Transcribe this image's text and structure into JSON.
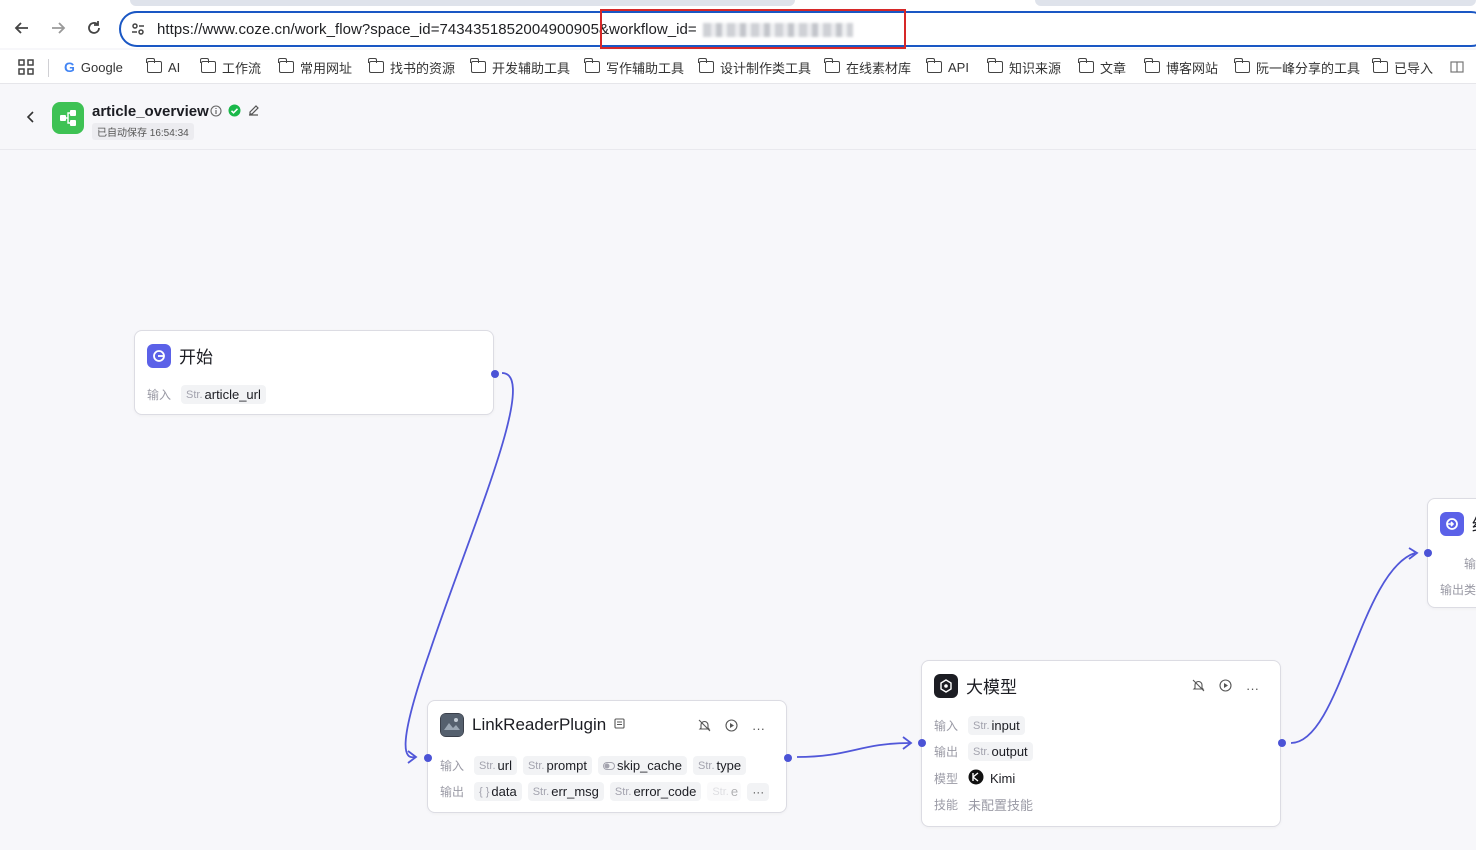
{
  "browser": {
    "url_prefix": "https://www.coze.cn/work_flow?space_id=7434351852004900905",
    "url_highlight": "&workflow_id=",
    "bookmarks": [
      {
        "label": "Google",
        "icon": "google-icon"
      },
      {
        "label": "AI",
        "icon": "folder-icon"
      },
      {
        "label": "工作流",
        "icon": "folder-icon"
      },
      {
        "label": "常用网址",
        "icon": "folder-icon"
      },
      {
        "label": "找书的资源",
        "icon": "folder-icon"
      },
      {
        "label": "开发辅助工具",
        "icon": "folder-icon"
      },
      {
        "label": "写作辅助工具",
        "icon": "folder-icon"
      },
      {
        "label": "设计制作类工具",
        "icon": "folder-icon"
      },
      {
        "label": "在线素材库",
        "icon": "folder-icon"
      },
      {
        "label": "API",
        "icon": "folder-icon"
      },
      {
        "label": "知识来源",
        "icon": "folder-icon"
      },
      {
        "label": "文章",
        "icon": "folder-icon"
      },
      {
        "label": "博客网站",
        "icon": "folder-icon"
      },
      {
        "label": "阮一峰分享的工具",
        "icon": "folder-icon"
      },
      {
        "label": "已导入",
        "icon": "folder-icon"
      }
    ]
  },
  "header": {
    "title": "article_overview",
    "autosave": "已自动保存 16:54:34",
    "status_color": "#1ab84a"
  },
  "nodes": {
    "start": {
      "title": "开始",
      "input_label": "输入",
      "inputs": [
        {
          "type": "Str.",
          "name": "article_url"
        }
      ]
    },
    "link_reader": {
      "title": "LinkReaderPlugin",
      "input_label": "输入",
      "output_label": "输出",
      "inputs": [
        {
          "type": "Str.",
          "name": "url"
        },
        {
          "type": "Str.",
          "name": "prompt"
        },
        {
          "type": "toggle",
          "name": "skip_cache"
        },
        {
          "type": "Str.",
          "name": "type"
        }
      ],
      "outputs": [
        {
          "type": "{ }",
          "name": "data"
        },
        {
          "type": "Str.",
          "name": "err_msg"
        },
        {
          "type": "Str.",
          "name": "error_code"
        },
        {
          "type": "Str.",
          "name": "e"
        }
      ],
      "more": "···"
    },
    "llm": {
      "title": "大模型",
      "input_label": "输入",
      "output_label": "输出",
      "model_label": "模型",
      "skill_label": "技能",
      "input": {
        "type": "Str.",
        "name": "input"
      },
      "output": {
        "type": "Str.",
        "name": "output"
      },
      "model": "Kimi",
      "skill": "未配置技能"
    },
    "end": {
      "title": "结",
      "input_label": "输",
      "output_label": "输出类"
    }
  },
  "colors": {
    "accent": "#4b53d6",
    "edge": "#5157d9",
    "brand_green": "#3ec254",
    "highlight_box": "#d62828"
  }
}
